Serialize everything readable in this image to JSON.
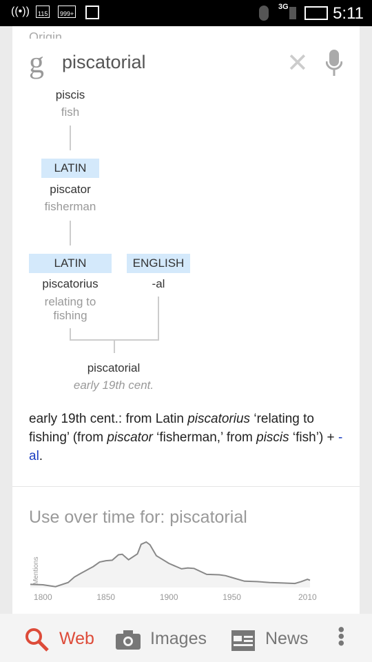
{
  "status_bar": {
    "notif_1": "115",
    "notif_2": "999+",
    "network": "3G",
    "time": "5:11"
  },
  "search": {
    "query": "piscatorial",
    "logo": "g"
  },
  "origin_peek": "Origin",
  "etymology": {
    "n1": {
      "word": "piscis",
      "meaning": "fish"
    },
    "n2": {
      "lang": "LATIN",
      "word": "piscator",
      "meaning": "fisherman"
    },
    "n3": {
      "lang": "LATIN",
      "word": "piscatorius",
      "meaning": "relating to fishing"
    },
    "n4": {
      "lang": "ENGLISH",
      "word": "-al"
    },
    "result": {
      "word": "piscatorial",
      "date": "early 19th cent."
    }
  },
  "description": {
    "p1": "early 19th cent.: from Latin ",
    "i1": "piscatorius",
    "p2": " ‘relating to fishing’ (from ",
    "i2": "piscator",
    "p3": " ‘fisherman,’ from ",
    "i3": "piscis",
    "p4": " ‘fish’) + ",
    "link": "-al",
    "p5": "."
  },
  "usage": {
    "title": "Use over time for: piscatorial"
  },
  "chart_data": {
    "type": "area",
    "ylabel": "Mentions",
    "xlabel": "",
    "x": [
      1790,
      1800,
      1810,
      1820,
      1825,
      1830,
      1840,
      1845,
      1850,
      1855,
      1860,
      1863,
      1868,
      1875,
      1878,
      1882,
      1885,
      1890,
      1900,
      1910,
      1915,
      1920,
      1930,
      1940,
      1945,
      1950,
      1960,
      1970,
      1980,
      1990,
      2000,
      2005,
      2010,
      2012
    ],
    "values": [
      7,
      6,
      2,
      11,
      23,
      31,
      46,
      56,
      59,
      60,
      72,
      73,
      61,
      74,
      95,
      100,
      94,
      70,
      53,
      41,
      43,
      42,
      29,
      28,
      26,
      22,
      14,
      13,
      11,
      10,
      9,
      13,
      18,
      16
    ],
    "xticks": [
      "1800",
      "1850",
      "1900",
      "1950",
      "2010"
    ],
    "xlim": [
      1790,
      2012
    ],
    "ylim": [
      0,
      100
    ],
    "grid": false
  },
  "nav": {
    "web": "Web",
    "images": "Images",
    "news": "News"
  },
  "colors": {
    "accent": "#dd4b39",
    "tag": "#d4e9fb",
    "link": "#1a3dc1"
  }
}
